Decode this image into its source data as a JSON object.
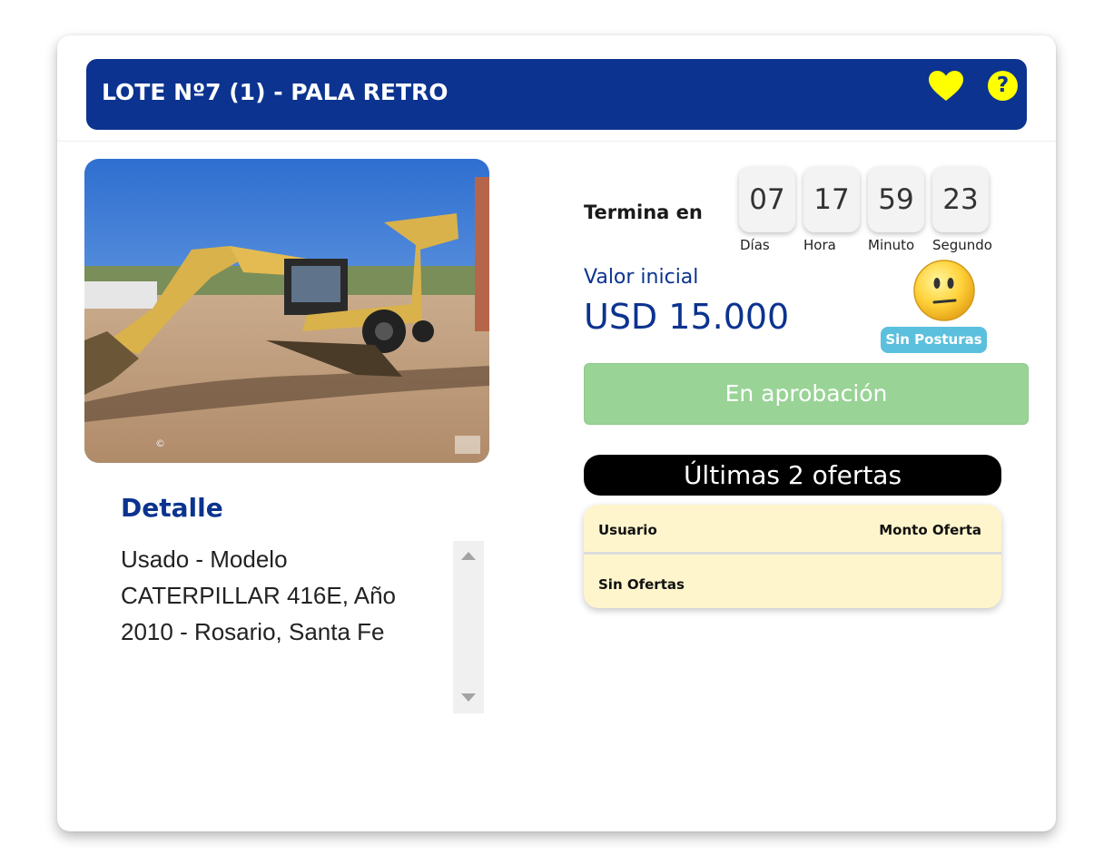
{
  "lot": {
    "title": "LOTE Nº7 (1) - PALA RETRO",
    "help_symbol": "?"
  },
  "photo": {
    "alt": "Retroexcavadora CATERPILLAR 416E",
    "watermark": "©"
  },
  "detail": {
    "heading": "Detalle",
    "description": "Usado - Modelo CATERPILLAR 416E, Año 2010 - Rosario, Santa Fe"
  },
  "countdown": {
    "label": "Termina en",
    "days": "07",
    "hours": "17",
    "minutes": "59",
    "seconds": "23",
    "days_label": "Días",
    "hours_label": "Hora",
    "minutes_label": "Minuto",
    "seconds_label": "Segundo"
  },
  "price": {
    "label": "Valor inicial",
    "amount": "USD 15.000"
  },
  "bids_status": {
    "badge": "Sin Posturas"
  },
  "status_button": {
    "label": "En aprobación"
  },
  "offers": {
    "title": "Últimas 2 ofertas",
    "col_user": "Usuario",
    "col_amount": "Monto Oferta",
    "empty_row": "Sin Ofertas"
  },
  "colors": {
    "header_bg": "#0b338f",
    "accent_yellow": "#ffff00",
    "status_green": "#99d396",
    "badge_blue": "#5bc0de",
    "table_bg": "#fff5cc"
  }
}
